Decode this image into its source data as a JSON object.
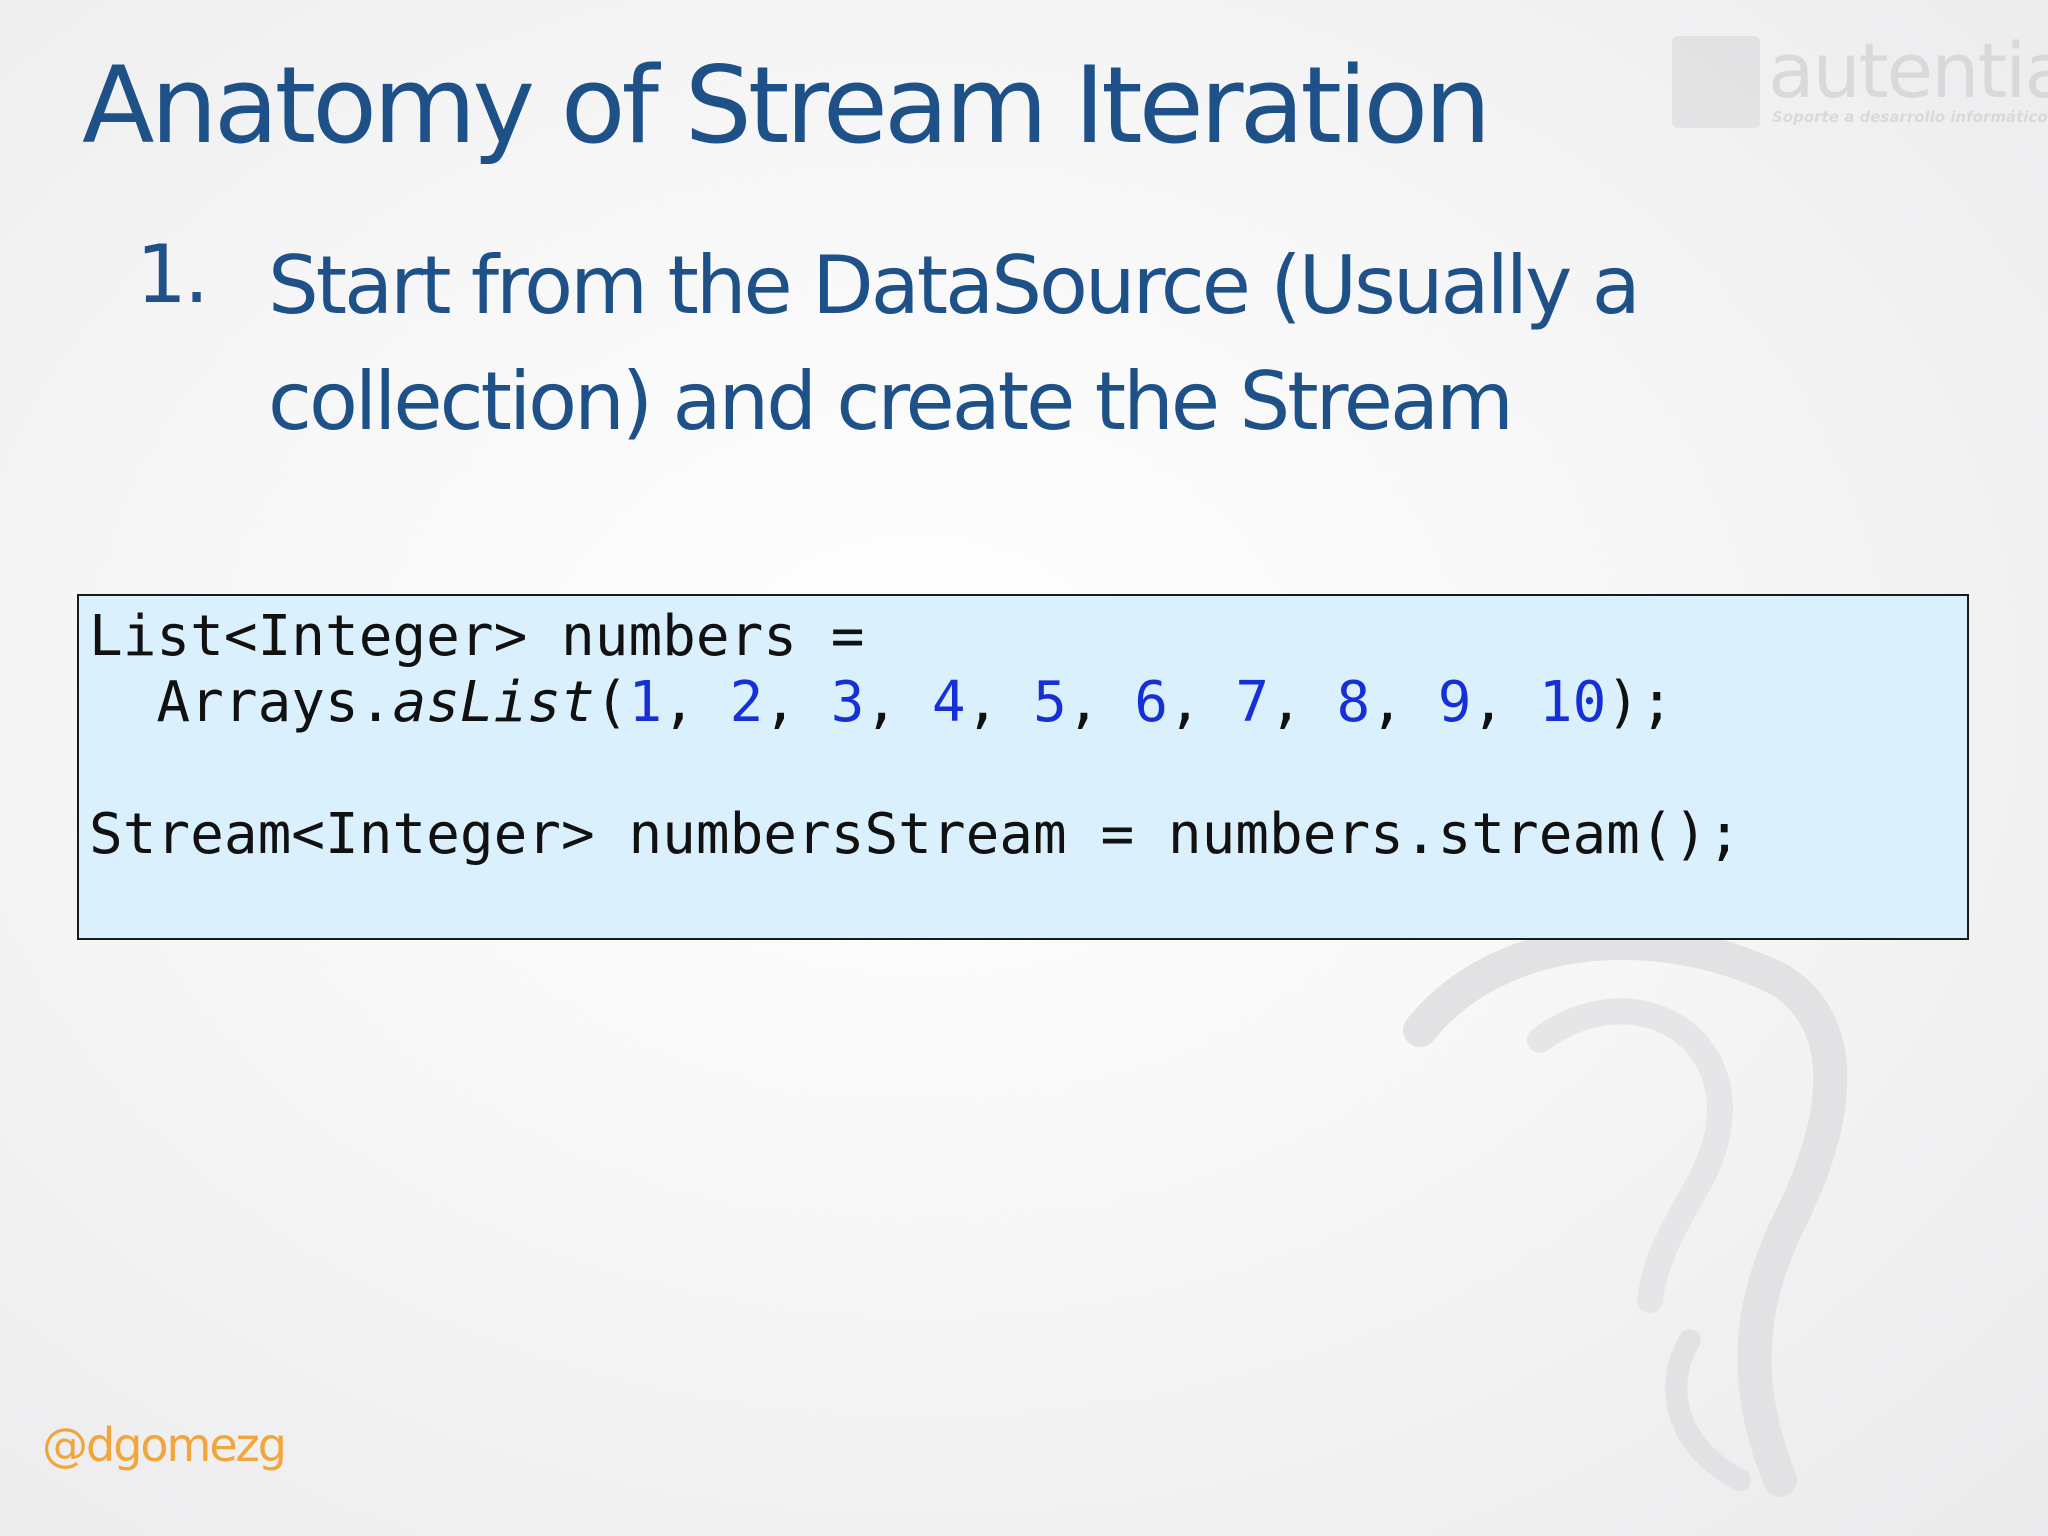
{
  "slide": {
    "title": "Anatomy of Stream Iteration",
    "step": {
      "number": "1.",
      "text": "Start from the DataSource (Usually a collection) and create the Stream"
    },
    "code": {
      "line1": "List<Integer> numbers =",
      "line2_prefix": "  Arrays.",
      "line2_method": "asList",
      "line2_open": "(",
      "numbers": [
        "1",
        "2",
        "3",
        "4",
        "5",
        "6",
        "7",
        "8",
        "9",
        "10"
      ],
      "line2_close": ");",
      "line3": "",
      "line4": "Stream<Integer> numbersStream = numbers.stream();"
    },
    "footer_handle": "@dgomezg"
  },
  "logo": {
    "word": "autentia",
    "tagline": "Soporte a desarrollo informático"
  },
  "colors": {
    "title": "#1f5189",
    "code_background": "#daf0fc",
    "code_number": "#1630d8",
    "handle": "#f1a53a"
  }
}
